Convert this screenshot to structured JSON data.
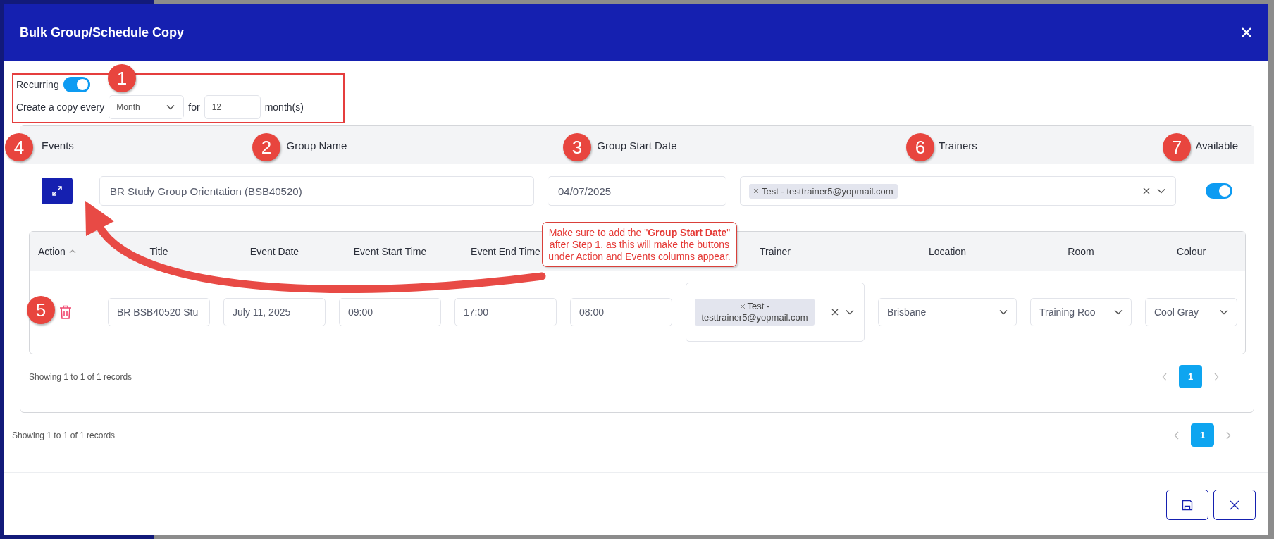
{
  "window": {
    "title": "Bulk Group/Schedule Copy"
  },
  "recurring": {
    "label": "Recurring",
    "on": true,
    "copy_label": "Create a copy every",
    "frequency": "Month",
    "for_label": "for",
    "count": "12",
    "unit": "month(s)"
  },
  "groups": {
    "columns": [
      "Events",
      "Group Name",
      "Group Start Date",
      "Trainers",
      "Available"
    ],
    "rows": [
      {
        "group_name": "BR Study Group Orientation (BSB40520)",
        "start_date": "04/07/2025",
        "trainers": [
          "Test - testtrainer5@yopmail.com"
        ],
        "available": true,
        "events": {
          "columns": [
            {
              "label": "Action",
              "sorted": true
            },
            {
              "label": "Title",
              "sorted": false
            },
            {
              "label": "Event Date",
              "sorted": false
            },
            {
              "label": "Event Start Time",
              "sorted": false
            },
            {
              "label": "Event End Time",
              "sorted": false
            },
            {},
            {
              "label": "Trainer",
              "sorted": false
            },
            {
              "label": "Location",
              "sorted": false
            },
            {
              "label": "Room",
              "sorted": false
            },
            {
              "label": "Colour",
              "sorted": false
            }
          ],
          "rows": [
            {
              "title": "BR BSB40520 Stu",
              "event_date": "July 11, 2025",
              "start_time": "09:00",
              "end_time": "17:00",
              "column_6": "08:00",
              "trainers": [
                "Test - testtrainer5@yopmail.com"
              ],
              "location": "Brisbane",
              "room": "Training Roo",
              "colour": "Cool Gray"
            }
          ],
          "footer": "Showing 1 to 1 of 1 records",
          "pages": [
            {
              "label": "1",
              "selected": true
            }
          ]
        }
      }
    ],
    "footer": "Showing 1 to 1 of 1 records",
    "pages": [
      {
        "label": "1",
        "selected": true
      }
    ]
  },
  "annotations": {
    "markers": [
      "1",
      "4",
      "2",
      "3",
      "6",
      "7",
      "5"
    ],
    "callout": "Make sure to add the \"**Group Start Date**\" after Step **1**, as this will make the buttons under Action and Events columns appear."
  }
}
